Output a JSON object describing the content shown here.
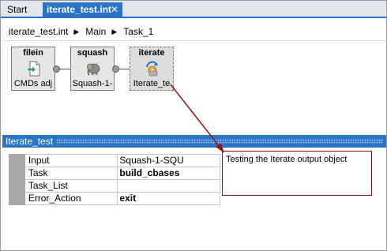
{
  "tabs": {
    "start_label": "Start",
    "active_label": "iterate_test.int",
    "close_glyph": "✕"
  },
  "breadcrumb": {
    "items": [
      "iterate_test.int",
      "Main",
      "Task_1"
    ],
    "separator": "▶"
  },
  "graph": {
    "nodes": [
      {
        "title": "filein",
        "subtitle": "CMDs adj",
        "icon": "file-import-icon"
      },
      {
        "title": "squash",
        "subtitle": "Squash-1-",
        "icon": "elephant-icon"
      },
      {
        "title": "iterate",
        "subtitle": "Iterate_te",
        "icon": "iterate-cog-icon"
      }
    ]
  },
  "properties": {
    "title": "Iterate_test",
    "rows": [
      {
        "key": "Input",
        "value": "Squash-1-SQU",
        "bold": false
      },
      {
        "key": "Task",
        "value": "build_cbases",
        "bold": true
      },
      {
        "key": "Task_List",
        "value": "",
        "bold": false
      },
      {
        "key": "Error_Action",
        "value": "exit",
        "bold": true
      }
    ]
  },
  "description": {
    "text": "Testing the Iterate output object"
  },
  "colors": {
    "accent": "#2a73c7",
    "annotation": "#8a1a1a",
    "tab_bar": "#e3e6ea"
  }
}
